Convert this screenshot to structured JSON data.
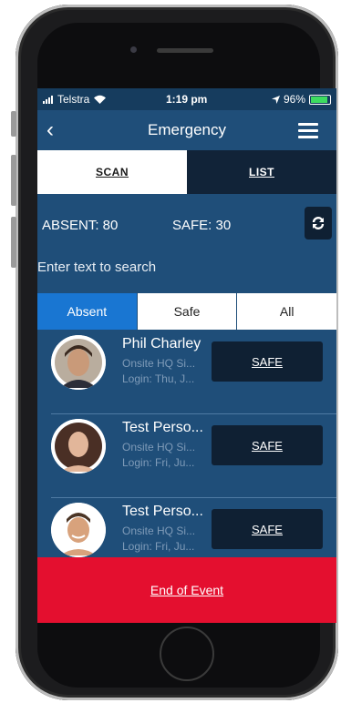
{
  "status": {
    "carrier": "Telstra",
    "time": "1:19 pm",
    "battery": "96%"
  },
  "nav": {
    "title": "Emergency"
  },
  "tabs": [
    {
      "label": "SCAN",
      "active": true
    },
    {
      "label": "LIST",
      "active": false
    }
  ],
  "counts": {
    "absent": "ABSENT:  80",
    "safe": "SAFE: 30"
  },
  "search": {
    "placeholder": "Enter text to search"
  },
  "filters": [
    "Absent",
    "Safe",
    "All"
  ],
  "people": [
    {
      "name": "Phil Charley",
      "location": "Onsite HQ Si...",
      "login": "Login: Thu, J...",
      "action": "SAFE"
    },
    {
      "name": "Test Perso...",
      "location": "Onsite HQ Si...",
      "login": "Login: Fri, Ju...",
      "action": "SAFE"
    },
    {
      "name": "Test Perso...",
      "location": "Onsite HQ Si...",
      "login": "Login: Fri, Ju...",
      "action": "SAFE"
    }
  ],
  "footer": {
    "label": "End of Event"
  },
  "colors": {
    "screen_bg": "#1f4e79",
    "end_button": "#e40f2f",
    "active_filter": "#1976d2"
  }
}
